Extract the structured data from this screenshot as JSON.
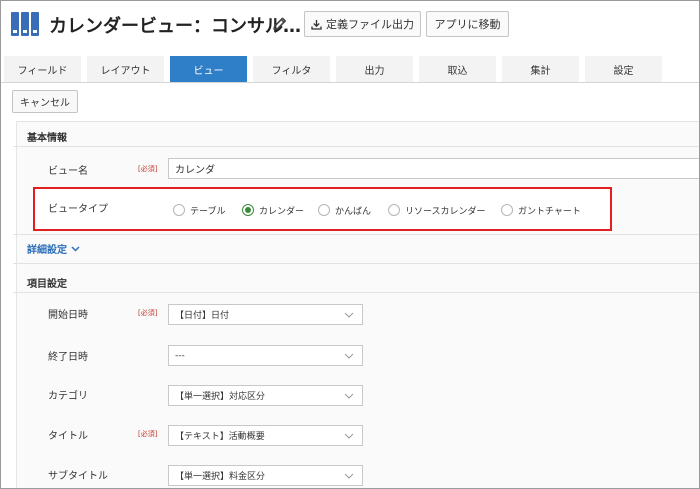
{
  "header": {
    "title": "カレンダービュー：コンサル…",
    "export_label": "定義ファイル出力",
    "open_app_label": "アプリに移動"
  },
  "tabs": [
    {
      "label": "フィールド",
      "active": false
    },
    {
      "label": "レイアウト",
      "active": false
    },
    {
      "label": "ビュー",
      "active": true
    },
    {
      "label": "フィルタ",
      "active": false
    },
    {
      "label": "出力",
      "active": false
    },
    {
      "label": "取込",
      "active": false
    },
    {
      "label": "集計",
      "active": false
    },
    {
      "label": "設定",
      "active": false
    }
  ],
  "cancel_label": "キャンセル",
  "basic": {
    "section_title": "基本情報",
    "view_name_label": "ビュー名",
    "required_tag": "[必須]",
    "view_name_value": "カレンダ",
    "view_type_label": "ビュータイプ",
    "view_types": [
      {
        "label": "テーブル",
        "checked": false
      },
      {
        "label": "カレンダー",
        "checked": true
      },
      {
        "label": "かんばん",
        "checked": false
      },
      {
        "label": "リソースカレンダー",
        "checked": false
      },
      {
        "label": "ガントチャート",
        "checked": false
      }
    ]
  },
  "detail_link": "詳細設定",
  "items": {
    "section_title": "項目設定",
    "rows": [
      {
        "label": "開始日時",
        "required": "[必須]",
        "value": "【日付】日付"
      },
      {
        "label": "終了日時",
        "required": "",
        "value": "---"
      },
      {
        "label": "カテゴリ",
        "required": "",
        "value": "【単一選択】対応区分"
      },
      {
        "label": "タイトル",
        "required": "[必須]",
        "value": "【テキスト】活動概要"
      },
      {
        "label": "サブタイトル",
        "required": "",
        "value": "【単一選択】料金区分"
      }
    ]
  },
  "colors": {
    "accent": "#2f7ec8",
    "radio_checked": "#3b8a3b",
    "highlight_border": "#e02020",
    "required_text": "#c0392b"
  }
}
